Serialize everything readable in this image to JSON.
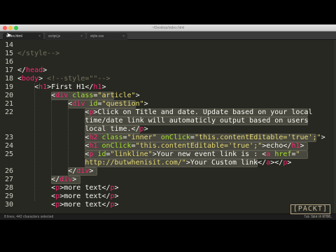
{
  "window": {
    "title": "~/Desktop/index.html"
  },
  "tabs": [
    {
      "label": "index.html",
      "active": true
    },
    {
      "label": "script.js",
      "active": false
    },
    {
      "label": "style.css",
      "active": false
    }
  ],
  "editor": {
    "lines": [
      {
        "num": "14",
        "tokens": []
      },
      {
        "num": "15",
        "tokens": [
          {
            "t": "</style-->",
            "c": "cmt"
          }
        ]
      },
      {
        "num": "16",
        "tokens": []
      },
      {
        "num": "17",
        "tokens": [
          {
            "t": "</",
            "c": "txt"
          },
          {
            "t": "head",
            "c": "tag"
          },
          {
            "t": ">",
            "c": "txt"
          }
        ]
      },
      {
        "num": "18",
        "tokens": [
          {
            "t": "<",
            "c": "txt"
          },
          {
            "t": "body",
            "c": "tag"
          },
          {
            "t": "> ",
            "c": "txt"
          },
          {
            "t": "<!--style=\"\"-->",
            "c": "cmt"
          }
        ]
      },
      {
        "num": "19",
        "tokens": [
          {
            "t": "    <",
            "c": "txt"
          },
          {
            "t": "h1",
            "c": "tag"
          },
          {
            "t": ">First H1</",
            "c": "txt"
          },
          {
            "t": "h1",
            "c": "tag"
          },
          {
            "t": ">",
            "c": "txt"
          }
        ]
      },
      {
        "num": "20",
        "tokens": [
          {
            "t": "        <",
            "c": "txt"
          },
          {
            "t": "div",
            "c": "tag"
          },
          {
            "t": " ",
            "c": "txt"
          },
          {
            "t": "class",
            "c": "attr"
          },
          {
            "t": "=",
            "c": "txt"
          },
          {
            "t": "\"article\"",
            "c": "str"
          },
          {
            "t": ">",
            "c": "txt"
          }
        ]
      },
      {
        "num": "21",
        "tokens": [
          {
            "t": "            <",
            "c": "txt"
          },
          {
            "t": "div",
            "c": "tag"
          },
          {
            "t": " ",
            "c": "txt"
          },
          {
            "t": "id",
            "c": "attr"
          },
          {
            "t": "=",
            "c": "txt"
          },
          {
            "t": "\"question\"",
            "c": "str"
          },
          {
            "t": ">",
            "c": "txt"
          }
        ]
      },
      {
        "num": "22",
        "tokens": [
          {
            "t": "                <",
            "c": "txt"
          },
          {
            "t": "p",
            "c": "tag"
          },
          {
            "t": ">Click on Title and date. Update based on your local",
            "c": "txt"
          }
        ]
      },
      {
        "num": "",
        "tokens": [
          {
            "t": "                time/date link will automaticly output based on users",
            "c": "txt"
          }
        ]
      },
      {
        "num": "",
        "tokens": [
          {
            "t": "                local time.</",
            "c": "txt"
          },
          {
            "t": "p",
            "c": "tag"
          },
          {
            "t": ">",
            "c": "txt"
          }
        ]
      },
      {
        "num": "23",
        "tokens": [
          {
            "t": "                <",
            "c": "txt"
          },
          {
            "t": "h2",
            "c": "tag"
          },
          {
            "t": " ",
            "c": "txt"
          },
          {
            "t": "class",
            "c": "attr"
          },
          {
            "t": "=",
            "c": "txt"
          },
          {
            "t": "\"inner\"",
            "c": "str"
          },
          {
            "t": " ",
            "c": "txt"
          },
          {
            "t": "onClick",
            "c": "attr"
          },
          {
            "t": "=",
            "c": "txt"
          },
          {
            "t": "\"this.contentEditable='true';\"",
            "c": "str"
          },
          {
            "t": ">",
            "c": "txt"
          }
        ]
      },
      {
        "num": "24",
        "tokens": [
          {
            "t": "                <",
            "c": "txt"
          },
          {
            "t": "h1",
            "c": "tag"
          },
          {
            "t": " ",
            "c": "txt"
          },
          {
            "t": "onClick",
            "c": "attr"
          },
          {
            "t": "=",
            "c": "txt"
          },
          {
            "t": "\"this.contentEditable='true';\"",
            "c": "str"
          },
          {
            "t": ">echo</",
            "c": "txt"
          },
          {
            "t": "h1",
            "c": "tag"
          },
          {
            "t": ">",
            "c": "txt"
          }
        ]
      },
      {
        "num": "25",
        "tokens": [
          {
            "t": "                <",
            "c": "txt"
          },
          {
            "t": "p",
            "c": "tag"
          },
          {
            "t": " ",
            "c": "txt"
          },
          {
            "t": "id",
            "c": "attr"
          },
          {
            "t": "=",
            "c": "txt"
          },
          {
            "t": "\"linkline\"",
            "c": "str"
          },
          {
            "t": ">Your new event link is : <",
            "c": "txt"
          },
          {
            "t": "a",
            "c": "tag"
          },
          {
            "t": " ",
            "c": "txt"
          },
          {
            "t": "href",
            "c": "attr"
          },
          {
            "t": "=",
            "c": "txt"
          },
          {
            "t": "\"",
            "c": "str"
          }
        ]
      },
      {
        "num": "",
        "tokens": [
          {
            "t": "                http://butwhenisit.com/\"",
            "c": "str"
          },
          {
            "t": ">Your Custom link</",
            "c": "txt"
          },
          {
            "t": "a",
            "c": "tag"
          },
          {
            "t": "></",
            "c": "txt"
          },
          {
            "t": "p",
            "c": "tag"
          },
          {
            "t": ">",
            "c": "txt"
          }
        ]
      },
      {
        "num": "26",
        "tokens": [
          {
            "t": "            </",
            "c": "txt"
          },
          {
            "t": "div",
            "c": "tag"
          },
          {
            "t": ">",
            "c": "txt"
          }
        ]
      },
      {
        "num": "27",
        "tokens": [
          {
            "t": "        </",
            "c": "txt"
          },
          {
            "t": "div",
            "c": "tag"
          },
          {
            "t": ">",
            "c": "txt"
          }
        ]
      },
      {
        "num": "28",
        "tokens": [
          {
            "t": "        <",
            "c": "txt"
          },
          {
            "t": "p",
            "c": "tag"
          },
          {
            "t": ">more text</",
            "c": "txt"
          },
          {
            "t": "p",
            "c": "tag"
          },
          {
            "t": ">",
            "c": "txt"
          }
        ]
      },
      {
        "num": "29",
        "tokens": [
          {
            "t": "        <",
            "c": "txt"
          },
          {
            "t": "p",
            "c": "tag"
          },
          {
            "t": ">more text</",
            "c": "txt"
          },
          {
            "t": "p",
            "c": "tag"
          },
          {
            "t": ">",
            "c": "txt"
          }
        ]
      },
      {
        "num": "30",
        "tokens": [
          {
            "t": "        <",
            "c": "txt"
          },
          {
            "t": "p",
            "c": "tag"
          },
          {
            "t": ">more text</",
            "c": "txt"
          },
          {
            "t": "p",
            "c": "tag"
          },
          {
            "t": ">",
            "c": "txt"
          }
        ]
      }
    ]
  },
  "status": {
    "left": "8 lines, 442 characters selected",
    "right": "Tab Size: 4     HTML"
  },
  "branding": {
    "logo": "[PACKT]",
    "sub": "VIDEO"
  },
  "colors": {
    "tag": "#f92672",
    "attr": "#a6e22e",
    "string": "#e6db74",
    "comment": "#75715e",
    "text": "#f8f8f2",
    "selection": "#49483e",
    "background": "#272822"
  }
}
